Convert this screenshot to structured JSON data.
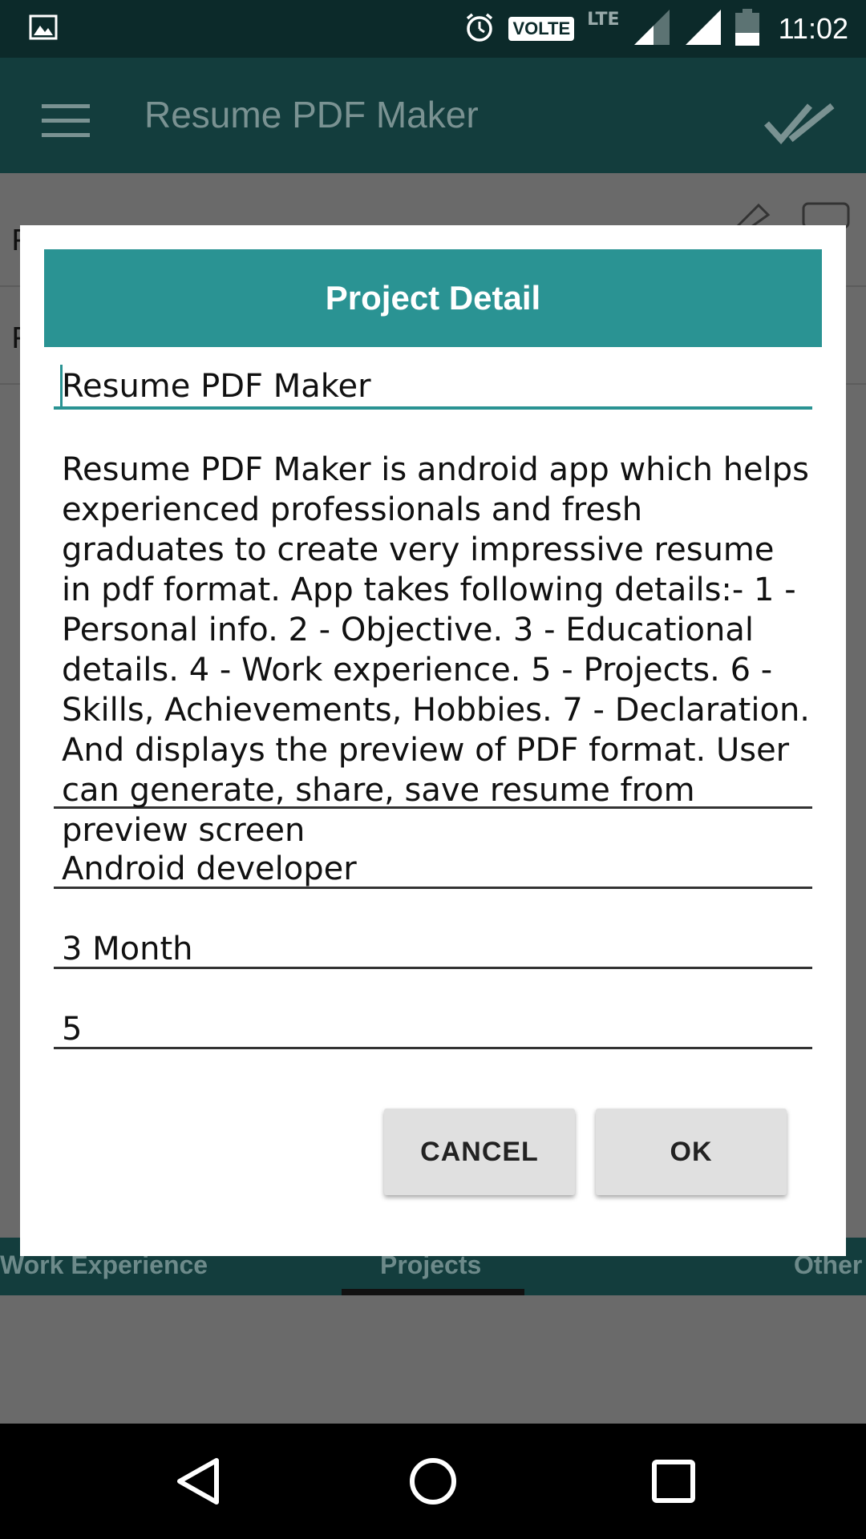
{
  "status_bar": {
    "volte": "VOLTE",
    "lte": "LTE",
    "time": "11:02",
    "icons": [
      "image-icon",
      "alarm-icon",
      "signal-icon",
      "battery-icon"
    ]
  },
  "app_bar": {
    "title": "Resume PDF Maker",
    "menu_icon": "hamburger-menu-icon",
    "done_icon": "double-check-icon"
  },
  "background": {
    "rows": [
      "P",
      "P"
    ],
    "tabs": [
      "Work Experience",
      "Projects",
      "Other"
    ]
  },
  "dialog": {
    "title": "Project Detail",
    "fields": {
      "project_name": "Resume PDF Maker",
      "description": "Resume PDF Maker is android app which helps experienced professionals and fresh graduates to create very impressive resume in pdf format. App takes following details:- 1 - Personal info. 2 - Objective. 3 - Educational details. 4 - Work experience. 5 - Projects. 6 - Skills, Achievements, Hobbies. 7 - Declaration. And displays the preview of PDF format. User can generate, share, save resume from preview screen",
      "role": "Android developer",
      "duration": "3 Month",
      "team_size": "5"
    },
    "buttons": {
      "cancel": "CANCEL",
      "ok": "OK"
    }
  },
  "colors": {
    "accent": "#2a9393",
    "status_bar": "#0c2a2a",
    "app_bar_dimmed": "#133d3d",
    "scrim": "#6a6a6a"
  }
}
